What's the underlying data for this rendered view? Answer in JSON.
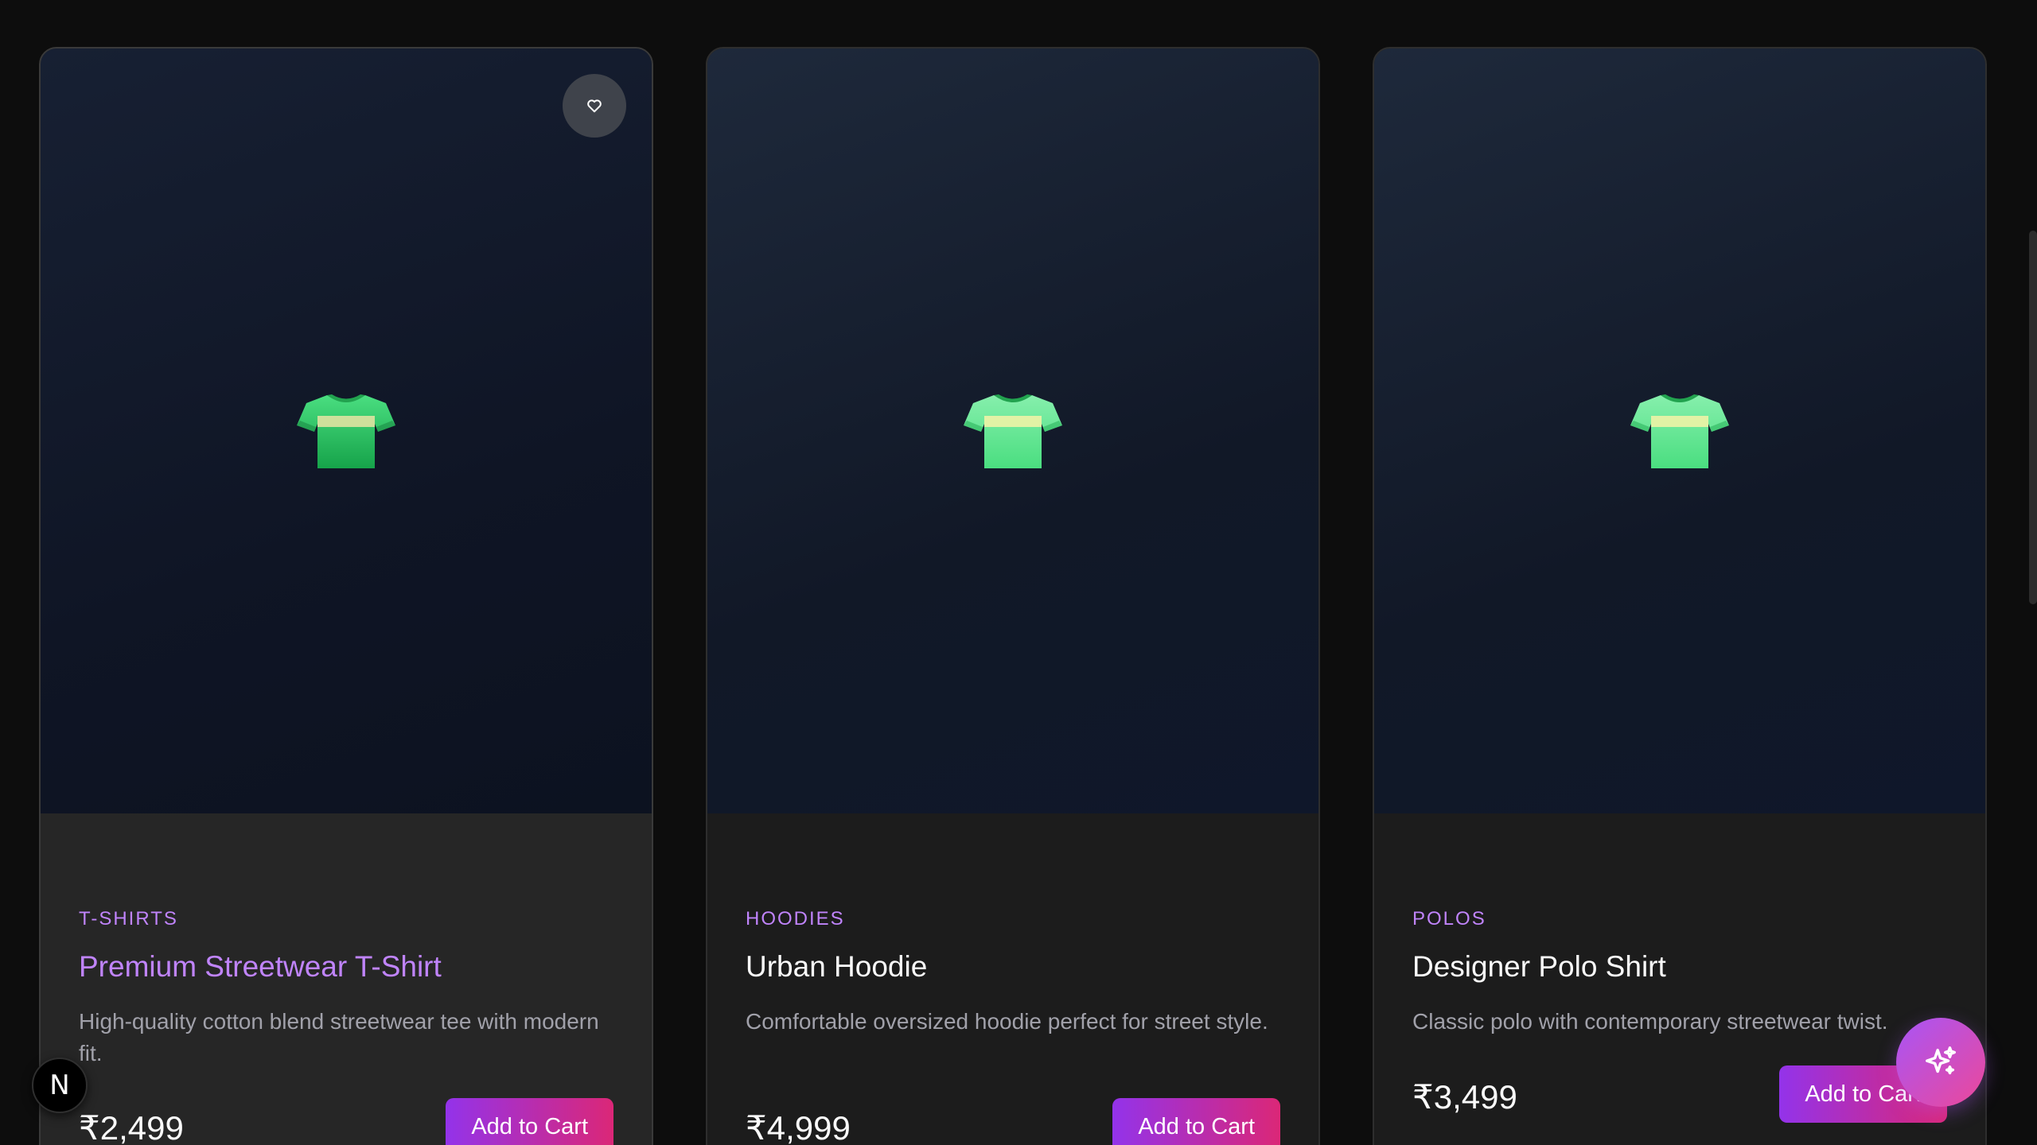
{
  "products": [
    {
      "category": "T-SHIRTS",
      "title": "Premium Streetwear T-Shirt",
      "description": "High-quality cotton blend streetwear tee with modern fit.",
      "price": "₹2,499",
      "cart_label": "Add to Cart",
      "image_icon": "tshirt-icon"
    },
    {
      "category": "HOODIES",
      "title": "Urban Hoodie",
      "description": "Comfortable oversized hoodie perfect for street style.",
      "price": "₹4,999",
      "cart_label": "Add to Cart",
      "image_icon": "tshirt-icon"
    },
    {
      "category": "POLOS",
      "title": "Designer Polo Shirt",
      "description": "Classic polo with contemporary streetwear twist.",
      "price": "₹3,499",
      "cart_label": "Add to Cart",
      "image_icon": "tshirt-icon"
    }
  ],
  "wishlist_icon": "heart-icon",
  "dev_badge": {
    "letter": "N"
  },
  "ai_button_icon": "sparkles-icon",
  "colors": {
    "accent": "#c084fc",
    "button_gradient_start": "#9333ea",
    "button_gradient_end": "#db2777",
    "background": "#0d0d0d"
  }
}
